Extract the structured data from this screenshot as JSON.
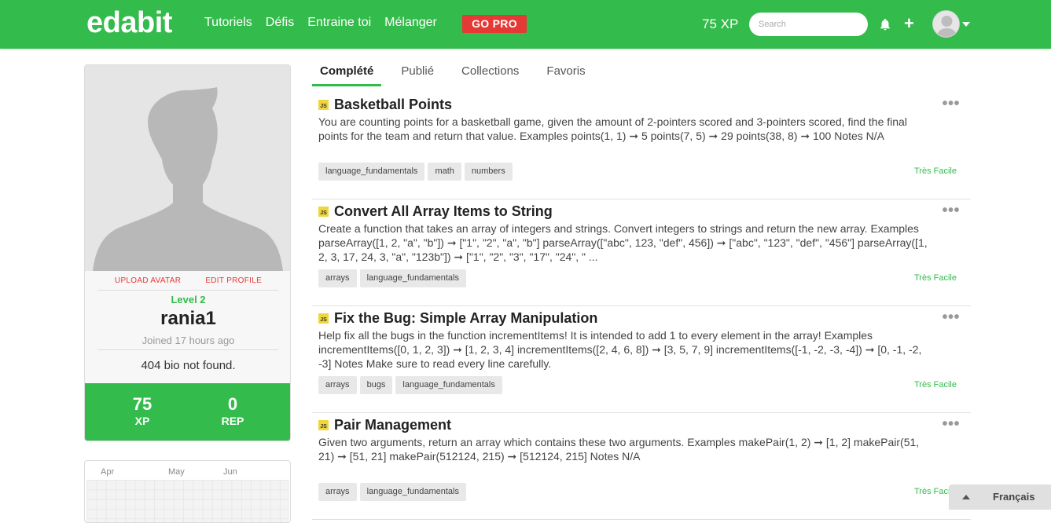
{
  "header": {
    "logo": "edabit",
    "nav": [
      "Tutoriels",
      "Défis",
      "Entraine toi",
      "Mélanger"
    ],
    "gopro_label": "GO PRO",
    "xp": "75 XP",
    "search_placeholder": "Search",
    "colors": {
      "brand_green": "#33bb4c",
      "gopro_red": "#e53935"
    }
  },
  "profile": {
    "upload_avatar": "UPLOAD AVATAR",
    "edit_profile": "EDIT PROFILE",
    "level": "Level 2",
    "username": "rania1",
    "joined": "Joined 17 hours ago",
    "bio": "404 bio not found.",
    "stats": {
      "xp_value": "75",
      "xp_label": "XP",
      "rep_value": "0",
      "rep_label": "REP"
    }
  },
  "calendar": {
    "months": [
      "Apr",
      "May",
      "Jun"
    ]
  },
  "tabs": [
    {
      "label": "Complété",
      "active": true
    },
    {
      "label": "Publié",
      "active": false
    },
    {
      "label": "Collections",
      "active": false
    },
    {
      "label": "Favoris",
      "active": false
    }
  ],
  "challenges": [
    {
      "lang": "JS",
      "title": "Basketball Points",
      "description": "You are counting points for a basketball game, given the amount of 2-pointers scored and 3-pointers scored, find the final points for the team and return that value. Examples points(1, 1) ➞ 5 points(7, 5) ➞ 29 points(38, 8) ➞ 100 Notes N/A",
      "tags": [
        "language_fundamentals",
        "math",
        "numbers"
      ],
      "difficulty": "Très Facile"
    },
    {
      "lang": "JS",
      "title": "Convert All Array Items to String",
      "description": "Create a function that takes an array of integers and strings. Convert integers to strings and return the new array. Examples parseArray([1, 2, \"a\", \"b\"]) ➞ [\"1\", \"2\", \"a\", \"b\"] parseArray([\"abc\", 123, \"def\", 456]) ➞ [\"abc\", \"123\", \"def\", \"456\"] parseArray([1, 2, 3, 17, 24, 3, \"a\", \"123b\"]) ➞ [\"1\", \"2\", \"3\", \"17\", \"24\", \" ...",
      "tags": [
        "arrays",
        "language_fundamentals"
      ],
      "difficulty": "Très Facile"
    },
    {
      "lang": "JS",
      "title": "Fix the Bug: Simple Array Manipulation",
      "description": "Help fix all the bugs in the function incrementItems! It is intended to add 1 to every element in the array! Examples incrementItems([0, 1, 2, 3]) ➞ [1, 2, 3, 4] incrementItems([2, 4, 6, 8]) ➞ [3, 5, 7, 9] incrementItems([-1, -2, -3, -4]) ➞ [0, -1, -2, -3] Notes Make sure to read every line carefully.",
      "tags": [
        "arrays",
        "bugs",
        "language_fundamentals"
      ],
      "difficulty": "Très Facile"
    },
    {
      "lang": "JS",
      "title": "Pair Management",
      "description": "Given two arguments, return an array which contains these two arguments. Examples makePair(1, 2) ➞ [1, 2] makePair(51, 21) ➞ [51, 21] makePair(512124, 215) ➞ [512124, 215] Notes N/A",
      "tags": [
        "arrays",
        "language_fundamentals"
      ],
      "difficulty": "Très Facile"
    }
  ],
  "language_bar": {
    "label": "Français"
  }
}
